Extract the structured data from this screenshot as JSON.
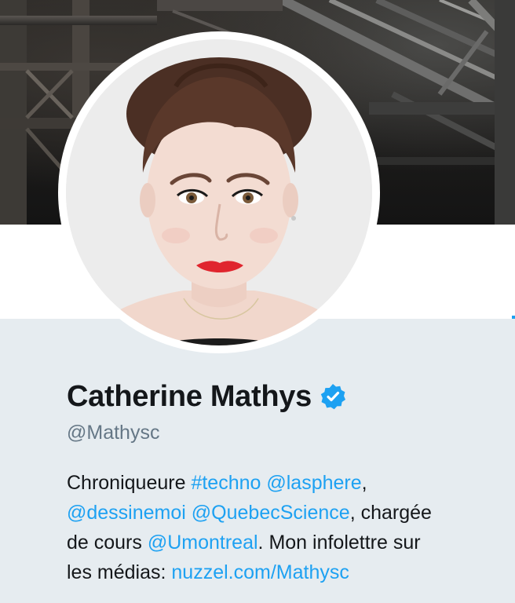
{
  "profile": {
    "name": "Catherine Mathys",
    "verified": true,
    "handle": "@Mathysc",
    "avatar_alt": "Catherine Mathys"
  },
  "bio": {
    "line1": {
      "t1": "Chroniqueure ",
      "hashtag_techno": "#techno",
      "sp1": " ",
      "mention_lasphere": "@lasphere",
      "t2": ","
    },
    "line2": {
      "mention_dessinemoi": "@dessinemoi",
      "sp1": " ",
      "mention_quebecscience": "@QuebecScience",
      "t2": ", chargée"
    },
    "line3": {
      "t1": "de cours ",
      "mention_umontreal": "@Umontreal",
      "t2": ". Mon infolettre sur"
    },
    "line4": {
      "t1": "les médias: ",
      "link_nuzzel": "nuzzel.com/Mathysc"
    }
  },
  "colors": {
    "link": "#1da1f2",
    "text": "#14171a",
    "muted": "#657786",
    "background": "#e6ecf0",
    "verified_badge": "#1da1f2"
  },
  "icons": {
    "verified": "verified-badge-icon"
  }
}
